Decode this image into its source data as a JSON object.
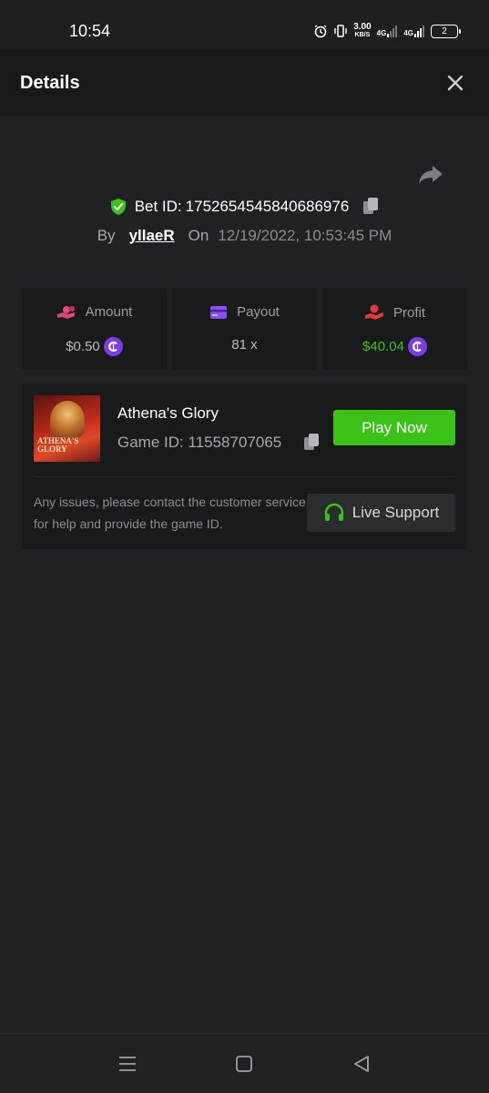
{
  "status_bar": {
    "time": "10:54",
    "net_speed_value": "3.00",
    "net_speed_unit": "KB/S",
    "network_1": "4G",
    "network_2": "4G",
    "battery": "2"
  },
  "header": {
    "title": "Details",
    "close_icon": "close-icon"
  },
  "bet": {
    "id_prefix": "Bet ID:",
    "id": "1752654545840686976",
    "by_label": "By",
    "user": "yllaeR",
    "on_label": "On",
    "date": "12/19/2022, 10:53:45 PM"
  },
  "stats": {
    "amount": {
      "label": "Amount",
      "value": "$0.50",
      "icon": "hand-coins-icon",
      "color": "#e0487a"
    },
    "payout": {
      "label": "Payout",
      "value": "81 x",
      "icon": "card-icon",
      "color": "#8b4cf0"
    },
    "profit": {
      "label": "Profit",
      "value": "$40.04",
      "icon": "profit-hand-icon",
      "color": "#e23b3b",
      "value_color": "#3bc117"
    }
  },
  "game": {
    "title": "Athena's Glory",
    "id_label": "Game ID:",
    "id": "11558707065",
    "thumbnail_text": "ATHENA'S GLORY",
    "play_label": "Play Now",
    "help_text": "Any issues, please contact the customer service for help and provide the game ID.",
    "support_label": "Live Support"
  },
  "colors": {
    "accent_green": "#3bc117",
    "coin_purple": "#7b3ce6",
    "background": "#202124",
    "card": "#191a1c"
  }
}
